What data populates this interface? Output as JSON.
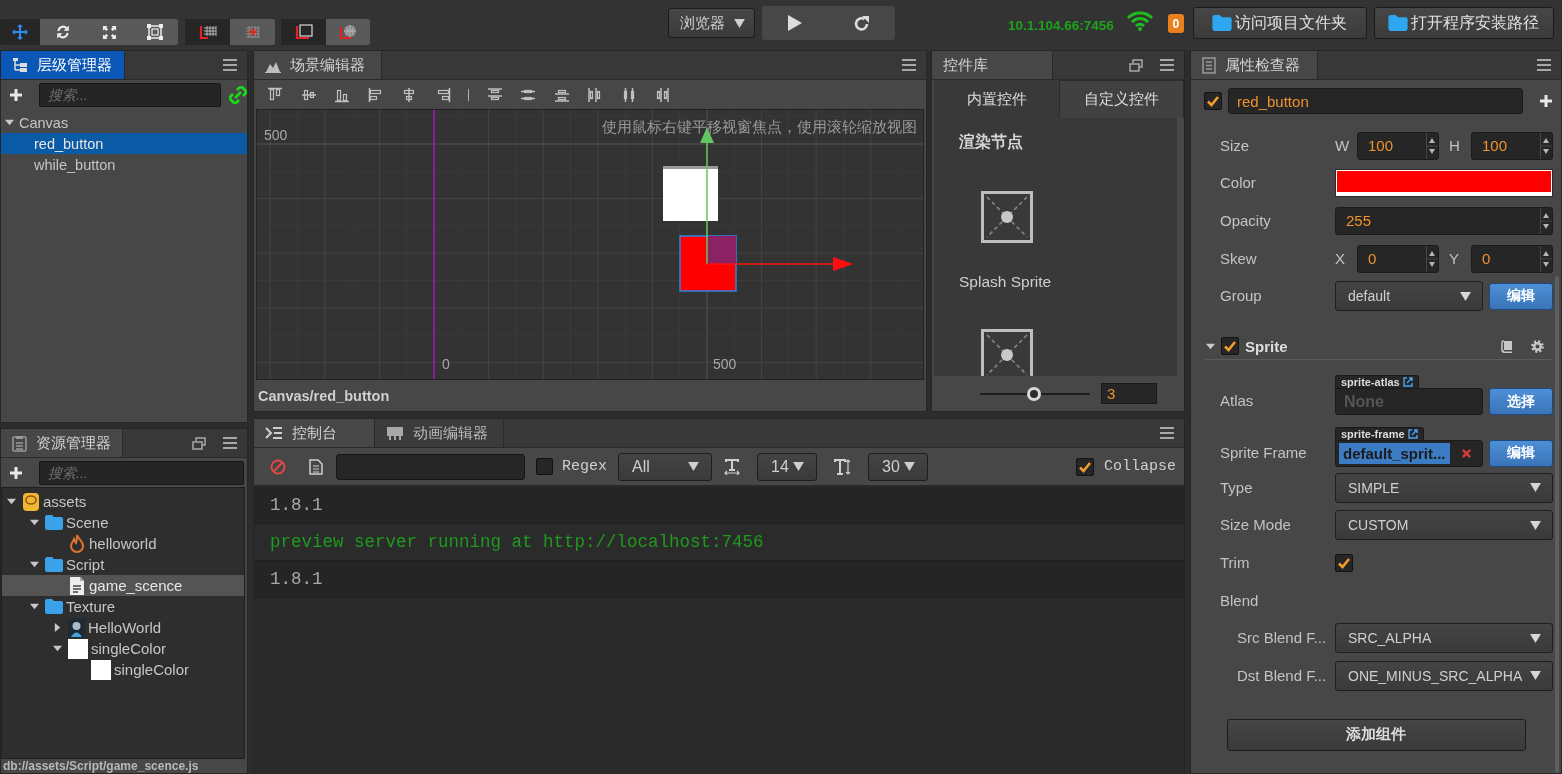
{
  "toolbar": {
    "tool_groups": [
      {
        "tools": [
          {
            "kind": "move",
            "selected": true
          },
          {
            "kind": "rotate",
            "selected": false
          },
          {
            "kind": "scale",
            "selected": false
          },
          {
            "kind": "rect",
            "selected": false
          }
        ]
      },
      {
        "tools": [
          {
            "kind": "pivot",
            "selected": true
          },
          {
            "kind": "center",
            "selected": false
          }
        ]
      },
      {
        "tools": [
          {
            "kind": "local",
            "selected": true
          },
          {
            "kind": "global",
            "selected": false
          }
        ]
      }
    ],
    "platform_select": {
      "value": "浏览器"
    },
    "run_buttons": [
      {
        "kind": "play"
      },
      {
        "kind": "refresh"
      }
    ],
    "server_address": "10.1.104.66:7456",
    "notification_count": "0",
    "buttons": [
      {
        "label": "访问项目文件夹"
      },
      {
        "label": "打开程序安装路径"
      }
    ]
  },
  "hierarchy": {
    "title": "层级管理器",
    "focused": true,
    "search": {
      "placeholder": "搜索..."
    },
    "tree": [
      {
        "label": "Canvas",
        "expanded": true,
        "selected": false,
        "children": [
          {
            "label": "red_button",
            "selected": true
          },
          {
            "label": "while_button",
            "selected": false
          }
        ]
      }
    ]
  },
  "assets": {
    "title": "资源管理器",
    "focused": false,
    "search": {
      "placeholder": "搜索..."
    },
    "tree": [
      {
        "label": "assets",
        "kind": "database",
        "expanded": true,
        "selected": false,
        "children": [
          {
            "label": "Scene",
            "kind": "folder",
            "expanded": true,
            "selected": false,
            "children": [
              {
                "label": "helloworld",
                "kind": "scene",
                "selected": false
              }
            ]
          },
          {
            "label": "Script",
            "kind": "folder",
            "expanded": true,
            "selected": false,
            "children": [
              {
                "label": "game_scence",
                "kind": "script",
                "selected": true
              }
            ]
          },
          {
            "label": "Texture",
            "kind": "folder",
            "expanded": true,
            "selected": false,
            "children": [
              {
                "label": "HelloWorld",
                "kind": "image",
                "expanded": false,
                "selected": false
              },
              {
                "label": "singleColor",
                "kind": "texture",
                "expanded": true,
                "selected": false,
                "children": [
                  {
                    "label": "singleColor",
                    "kind": "sprite_frame",
                    "selected": false
                  }
                ]
              }
            ]
          }
        ]
      }
    ],
    "status_path": "db://assets/Script/game_scence.js"
  },
  "scene_editor": {
    "title": "场景编辑器",
    "focused": false,
    "hint": "使用鼠标右键平移视窗焦点，使用滚轮缩放视图",
    "y_axis_label": "500",
    "x_axis_labels": [
      "0",
      "500"
    ],
    "path": "Canvas/red_button"
  },
  "widget_library": {
    "title": "控件库",
    "focused": false,
    "tabs": [
      {
        "label": "内置控件",
        "selected": true
      },
      {
        "label": "自定义控件",
        "selected": false
      }
    ],
    "section": "渲染节点",
    "items": [
      {
        "kind": "sprite",
        "label": "Splash Sprite"
      },
      {
        "kind": "sprite"
      }
    ],
    "zoom": {
      "level": 0.49,
      "value": "3"
    }
  },
  "console": {
    "tabs": [
      {
        "kind": "console",
        "label": "控制台",
        "selected": true
      },
      {
        "kind": "animation",
        "label": "动画编辑器",
        "selected": false
      }
    ],
    "regex": {
      "label": "Regex",
      "checked": false
    },
    "level_select": {
      "value": "All"
    },
    "font_size_select": {
      "value": "14"
    },
    "line_height_select": {
      "value": "30"
    },
    "collapse": {
      "label": "Collapse",
      "checked": true
    },
    "logs": [
      {
        "kind": "log",
        "text": "1.8.1"
      },
      {
        "kind": "success",
        "text": "preview server running at http://localhost:7456"
      },
      {
        "kind": "log",
        "text": "1.8.1"
      }
    ]
  },
  "inspector": {
    "title": "属性检查器",
    "focused": false,
    "node": {
      "active": true,
      "name": "red_button"
    },
    "properties": [
      {
        "kind": "pair",
        "label": "Size",
        "fields": [
          {
            "axis": "W",
            "value": "100"
          },
          {
            "axis": "H",
            "value": "100"
          }
        ]
      },
      {
        "kind": "color",
        "label": "Color",
        "color": "#ff0000"
      },
      {
        "kind": "number",
        "label": "Opacity",
        "value": "255"
      },
      {
        "kind": "pair",
        "label": "Skew",
        "fields": [
          {
            "axis": "X",
            "value": "0"
          },
          {
            "axis": "Y",
            "value": "0"
          }
        ]
      },
      {
        "kind": "select",
        "label": "Group",
        "value": "default",
        "button": "编辑"
      }
    ],
    "components": [
      {
        "name": "Sprite",
        "expanded": true,
        "enabled": true,
        "properties": [
          {
            "kind": "asset",
            "label": "Atlas",
            "tag": "sprite-atlas",
            "placeholder": "None",
            "button": "选择"
          },
          {
            "kind": "asset",
            "label": "Sprite Frame",
            "tag": "sprite-frame",
            "value": "default_sprit...",
            "button": "编辑"
          },
          {
            "kind": "select",
            "label": "Type",
            "value": "SIMPLE"
          },
          {
            "kind": "select",
            "label": "Size Mode",
            "value": "CUSTOM"
          },
          {
            "kind": "checkbox",
            "label": "Trim",
            "checked": true
          },
          {
            "kind": "group",
            "label": "Blend",
            "children": [
              {
                "kind": "select",
                "label": "Src Blend F...",
                "value": "SRC_ALPHA"
              },
              {
                "kind": "select",
                "label": "Dst Blend F...",
                "value": "ONE_MINUS_SRC_ALPHA"
              }
            ]
          }
        ]
      }
    ],
    "add_component_button": "添加组件"
  }
}
